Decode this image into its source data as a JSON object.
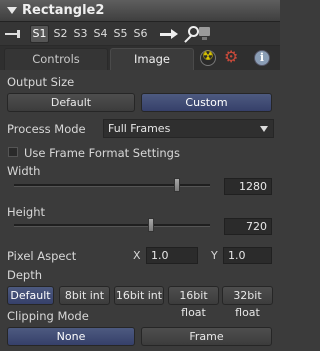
{
  "tool": {
    "title": "Rectangle2"
  },
  "toolbar": {
    "slots": [
      "S1",
      "S2",
      "S3",
      "S4",
      "S5",
      "S6"
    ],
    "active_slot": "S1"
  },
  "tabs": [
    {
      "label": "Controls",
      "selected": false
    },
    {
      "label": "Image",
      "selected": true
    }
  ],
  "output_size": {
    "label": "Output Size",
    "options": [
      "Default",
      "Custom"
    ],
    "selected": "Custom"
  },
  "process_mode": {
    "label": "Process Mode",
    "value": "Full Frames"
  },
  "use_frame_format": {
    "label": "Use Frame Format Settings",
    "checked": false
  },
  "width": {
    "label": "Width",
    "value": "1280",
    "slider_fraction": 0.83
  },
  "height": {
    "label": "Height",
    "value": "720",
    "slider_fraction": 0.7
  },
  "pixel_aspect": {
    "label": "Pixel Aspect",
    "x_label": "X",
    "x_value": "1.0",
    "y_label": "Y",
    "y_value": "1.0"
  },
  "depth": {
    "label": "Depth",
    "options": [
      "Default",
      "8bit int",
      "16bit int",
      "16bit float",
      "32bit float"
    ],
    "selected": "Default"
  },
  "clipping_mode": {
    "label": "Clipping Mode",
    "options": [
      "None",
      "Frame"
    ],
    "selected": "None"
  },
  "colors": {
    "accent": "#3e4a78",
    "background": "#3b3b3b",
    "radiation": "#d9c400",
    "gear": "#c94a3a"
  }
}
